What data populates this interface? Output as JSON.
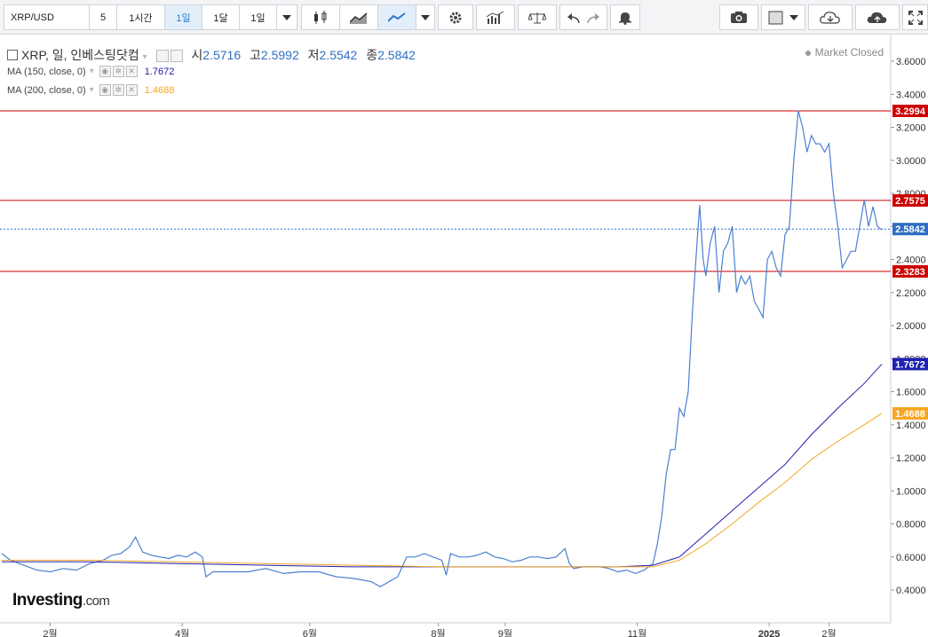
{
  "toolbar": {
    "symbol": "XRP/USD",
    "intervals": [
      "5",
      "1시간",
      "1일",
      "1달",
      "1일"
    ],
    "active_interval": "1일"
  },
  "legend": {
    "title": "XRP, 일, 인베스팅닷컴",
    "open_label": "시",
    "open": "2.5716",
    "high_label": "고",
    "high": "2.5992",
    "low_label": "저",
    "low": "2.5542",
    "close_label": "종",
    "close": "2.5842"
  },
  "indicators": [
    {
      "label": "MA (150, close, 0)",
      "value": "1.7672",
      "color": "#1a1aa6"
    },
    {
      "label": "MA (200, close, 0)",
      "value": "1.4688",
      "color": "#f5a623"
    }
  ],
  "status": "Market Closed",
  "logo": {
    "main": "Investing",
    "suffix": ".com"
  },
  "colors": {
    "price": "#4a80d1",
    "ma150": "#2020b0",
    "ma200": "#f5a623",
    "hline": "#cc0000",
    "last": "#2f6fc2"
  },
  "chart_data": {
    "type": "line",
    "y_axis": {
      "range": [
        0.3,
        3.7
      ],
      "ticks": [
        "0.4000",
        "0.6000",
        "0.8000",
        "1.0000",
        "1.2000",
        "1.4000",
        "1.6000",
        "1.8000",
        "2.0000",
        "2.2000",
        "2.4000",
        "2.6000",
        "2.8000",
        "3.0000",
        "3.2000",
        "3.4000",
        "3.6000"
      ]
    },
    "x_axis": {
      "ticks": [
        {
          "label": "2월",
          "t": 0.055
        },
        {
          "label": "4월",
          "t": 0.205
        },
        {
          "label": "6월",
          "t": 0.35
        },
        {
          "label": "8월",
          "t": 0.496
        },
        {
          "label": "9월",
          "t": 0.572
        },
        {
          "label": "11월",
          "t": 0.722
        },
        {
          "label": "2025",
          "t": 0.872,
          "bold": true
        },
        {
          "label": "2월",
          "t": 0.94
        }
      ]
    },
    "horizontal_lines": [
      {
        "value": 3.2994,
        "label": "3.2994"
      },
      {
        "value": 2.7575,
        "label": "2.7575"
      },
      {
        "value": 2.3283,
        "label": "2.3283"
      }
    ],
    "last_price": {
      "value": 2.5842,
      "label": "2.5842"
    },
    "series": [
      {
        "name": "XRP",
        "points": [
          [
            0,
            0.62
          ],
          [
            0.01,
            0.58
          ],
          [
            0.025,
            0.55
          ],
          [
            0.04,
            0.52
          ],
          [
            0.055,
            0.51
          ],
          [
            0.07,
            0.53
          ],
          [
            0.085,
            0.52
          ],
          [
            0.1,
            0.56
          ],
          [
            0.115,
            0.58
          ],
          [
            0.125,
            0.61
          ],
          [
            0.135,
            0.62
          ],
          [
            0.145,
            0.66
          ],
          [
            0.152,
            0.72
          ],
          [
            0.16,
            0.63
          ],
          [
            0.17,
            0.61
          ],
          [
            0.18,
            0.6
          ],
          [
            0.19,
            0.59
          ],
          [
            0.2,
            0.61
          ],
          [
            0.21,
            0.6
          ],
          [
            0.22,
            0.63
          ],
          [
            0.228,
            0.6
          ],
          [
            0.232,
            0.48
          ],
          [
            0.24,
            0.51
          ],
          [
            0.26,
            0.51
          ],
          [
            0.28,
            0.51
          ],
          [
            0.3,
            0.53
          ],
          [
            0.32,
            0.5
          ],
          [
            0.34,
            0.51
          ],
          [
            0.36,
            0.51
          ],
          [
            0.38,
            0.48
          ],
          [
            0.4,
            0.47
          ],
          [
            0.42,
            0.45
          ],
          [
            0.43,
            0.42
          ],
          [
            0.44,
            0.45
          ],
          [
            0.45,
            0.48
          ],
          [
            0.46,
            0.6
          ],
          [
            0.47,
            0.6
          ],
          [
            0.48,
            0.62
          ],
          [
            0.49,
            0.6
          ],
          [
            0.5,
            0.58
          ],
          [
            0.505,
            0.49
          ],
          [
            0.51,
            0.62
          ],
          [
            0.52,
            0.6
          ],
          [
            0.53,
            0.6
          ],
          [
            0.54,
            0.61
          ],
          [
            0.55,
            0.63
          ],
          [
            0.56,
            0.6
          ],
          [
            0.57,
            0.59
          ],
          [
            0.58,
            0.57
          ],
          [
            0.59,
            0.58
          ],
          [
            0.6,
            0.6
          ],
          [
            0.61,
            0.6
          ],
          [
            0.62,
            0.59
          ],
          [
            0.63,
            0.6
          ],
          [
            0.64,
            0.65
          ],
          [
            0.645,
            0.56
          ],
          [
            0.65,
            0.53
          ],
          [
            0.66,
            0.54
          ],
          [
            0.67,
            0.54
          ],
          [
            0.68,
            0.54
          ],
          [
            0.69,
            0.53
          ],
          [
            0.7,
            0.51
          ],
          [
            0.71,
            0.52
          ],
          [
            0.72,
            0.5
          ],
          [
            0.73,
            0.52
          ],
          [
            0.74,
            0.56
          ],
          [
            0.745,
            0.68
          ],
          [
            0.75,
            0.85
          ],
          [
            0.755,
            1.1
          ],
          [
            0.76,
            1.25
          ],
          [
            0.765,
            1.25
          ],
          [
            0.77,
            1.5
          ],
          [
            0.775,
            1.45
          ],
          [
            0.78,
            1.6
          ],
          [
            0.785,
            2.1
          ],
          [
            0.79,
            2.5
          ],
          [
            0.793,
            2.73
          ],
          [
            0.797,
            2.4
          ],
          [
            0.8,
            2.3
          ],
          [
            0.805,
            2.5
          ],
          [
            0.81,
            2.6
          ],
          [
            0.815,
            2.2
          ],
          [
            0.82,
            2.45
          ],
          [
            0.825,
            2.5
          ],
          [
            0.83,
            2.6
          ],
          [
            0.835,
            2.2
          ],
          [
            0.84,
            2.3
          ],
          [
            0.845,
            2.25
          ],
          [
            0.85,
            2.3
          ],
          [
            0.855,
            2.15
          ],
          [
            0.86,
            2.1
          ],
          [
            0.865,
            2.05
          ],
          [
            0.87,
            2.4
          ],
          [
            0.875,
            2.45
          ],
          [
            0.88,
            2.35
          ],
          [
            0.885,
            2.3
          ],
          [
            0.89,
            2.55
          ],
          [
            0.895,
            2.6
          ],
          [
            0.9,
            3.0
          ],
          [
            0.905,
            3.3
          ],
          [
            0.91,
            3.2
          ],
          [
            0.915,
            3.05
          ],
          [
            0.92,
            3.15
          ],
          [
            0.925,
            3.1
          ],
          [
            0.93,
            3.1
          ],
          [
            0.935,
            3.05
          ],
          [
            0.94,
            3.1
          ],
          [
            0.945,
            2.8
          ],
          [
            0.95,
            2.6
          ],
          [
            0.955,
            2.35
          ],
          [
            0.96,
            2.4
          ],
          [
            0.965,
            2.45
          ],
          [
            0.97,
            2.45
          ],
          [
            0.975,
            2.6
          ],
          [
            0.98,
            2.76
          ],
          [
            0.985,
            2.6
          ],
          [
            0.99,
            2.72
          ],
          [
            0.995,
            2.6
          ],
          [
            1.0,
            2.58
          ]
        ]
      },
      {
        "name": "MA (150, close, 0)",
        "points": [
          [
            0,
            0.57
          ],
          [
            0.1,
            0.57
          ],
          [
            0.2,
            0.56
          ],
          [
            0.3,
            0.55
          ],
          [
            0.4,
            0.54
          ],
          [
            0.5,
            0.54
          ],
          [
            0.6,
            0.54
          ],
          [
            0.7,
            0.54
          ],
          [
            0.74,
            0.55
          ],
          [
            0.77,
            0.6
          ],
          [
            0.8,
            0.74
          ],
          [
            0.83,
            0.88
          ],
          [
            0.86,
            1.02
          ],
          [
            0.89,
            1.16
          ],
          [
            0.92,
            1.34
          ],
          [
            0.95,
            1.5
          ],
          [
            0.98,
            1.65
          ],
          [
            1.0,
            1.7672
          ]
        ]
      },
      {
        "name": "MA (200, close, 0)",
        "points": [
          [
            0,
            0.58
          ],
          [
            0.1,
            0.58
          ],
          [
            0.2,
            0.57
          ],
          [
            0.3,
            0.56
          ],
          [
            0.4,
            0.55
          ],
          [
            0.5,
            0.54
          ],
          [
            0.6,
            0.54
          ],
          [
            0.7,
            0.54
          ],
          [
            0.74,
            0.54
          ],
          [
            0.77,
            0.58
          ],
          [
            0.8,
            0.68
          ],
          [
            0.83,
            0.8
          ],
          [
            0.86,
            0.93
          ],
          [
            0.89,
            1.05
          ],
          [
            0.92,
            1.19
          ],
          [
            0.95,
            1.3
          ],
          [
            0.98,
            1.4
          ],
          [
            1.0,
            1.4688
          ]
        ]
      }
    ]
  }
}
